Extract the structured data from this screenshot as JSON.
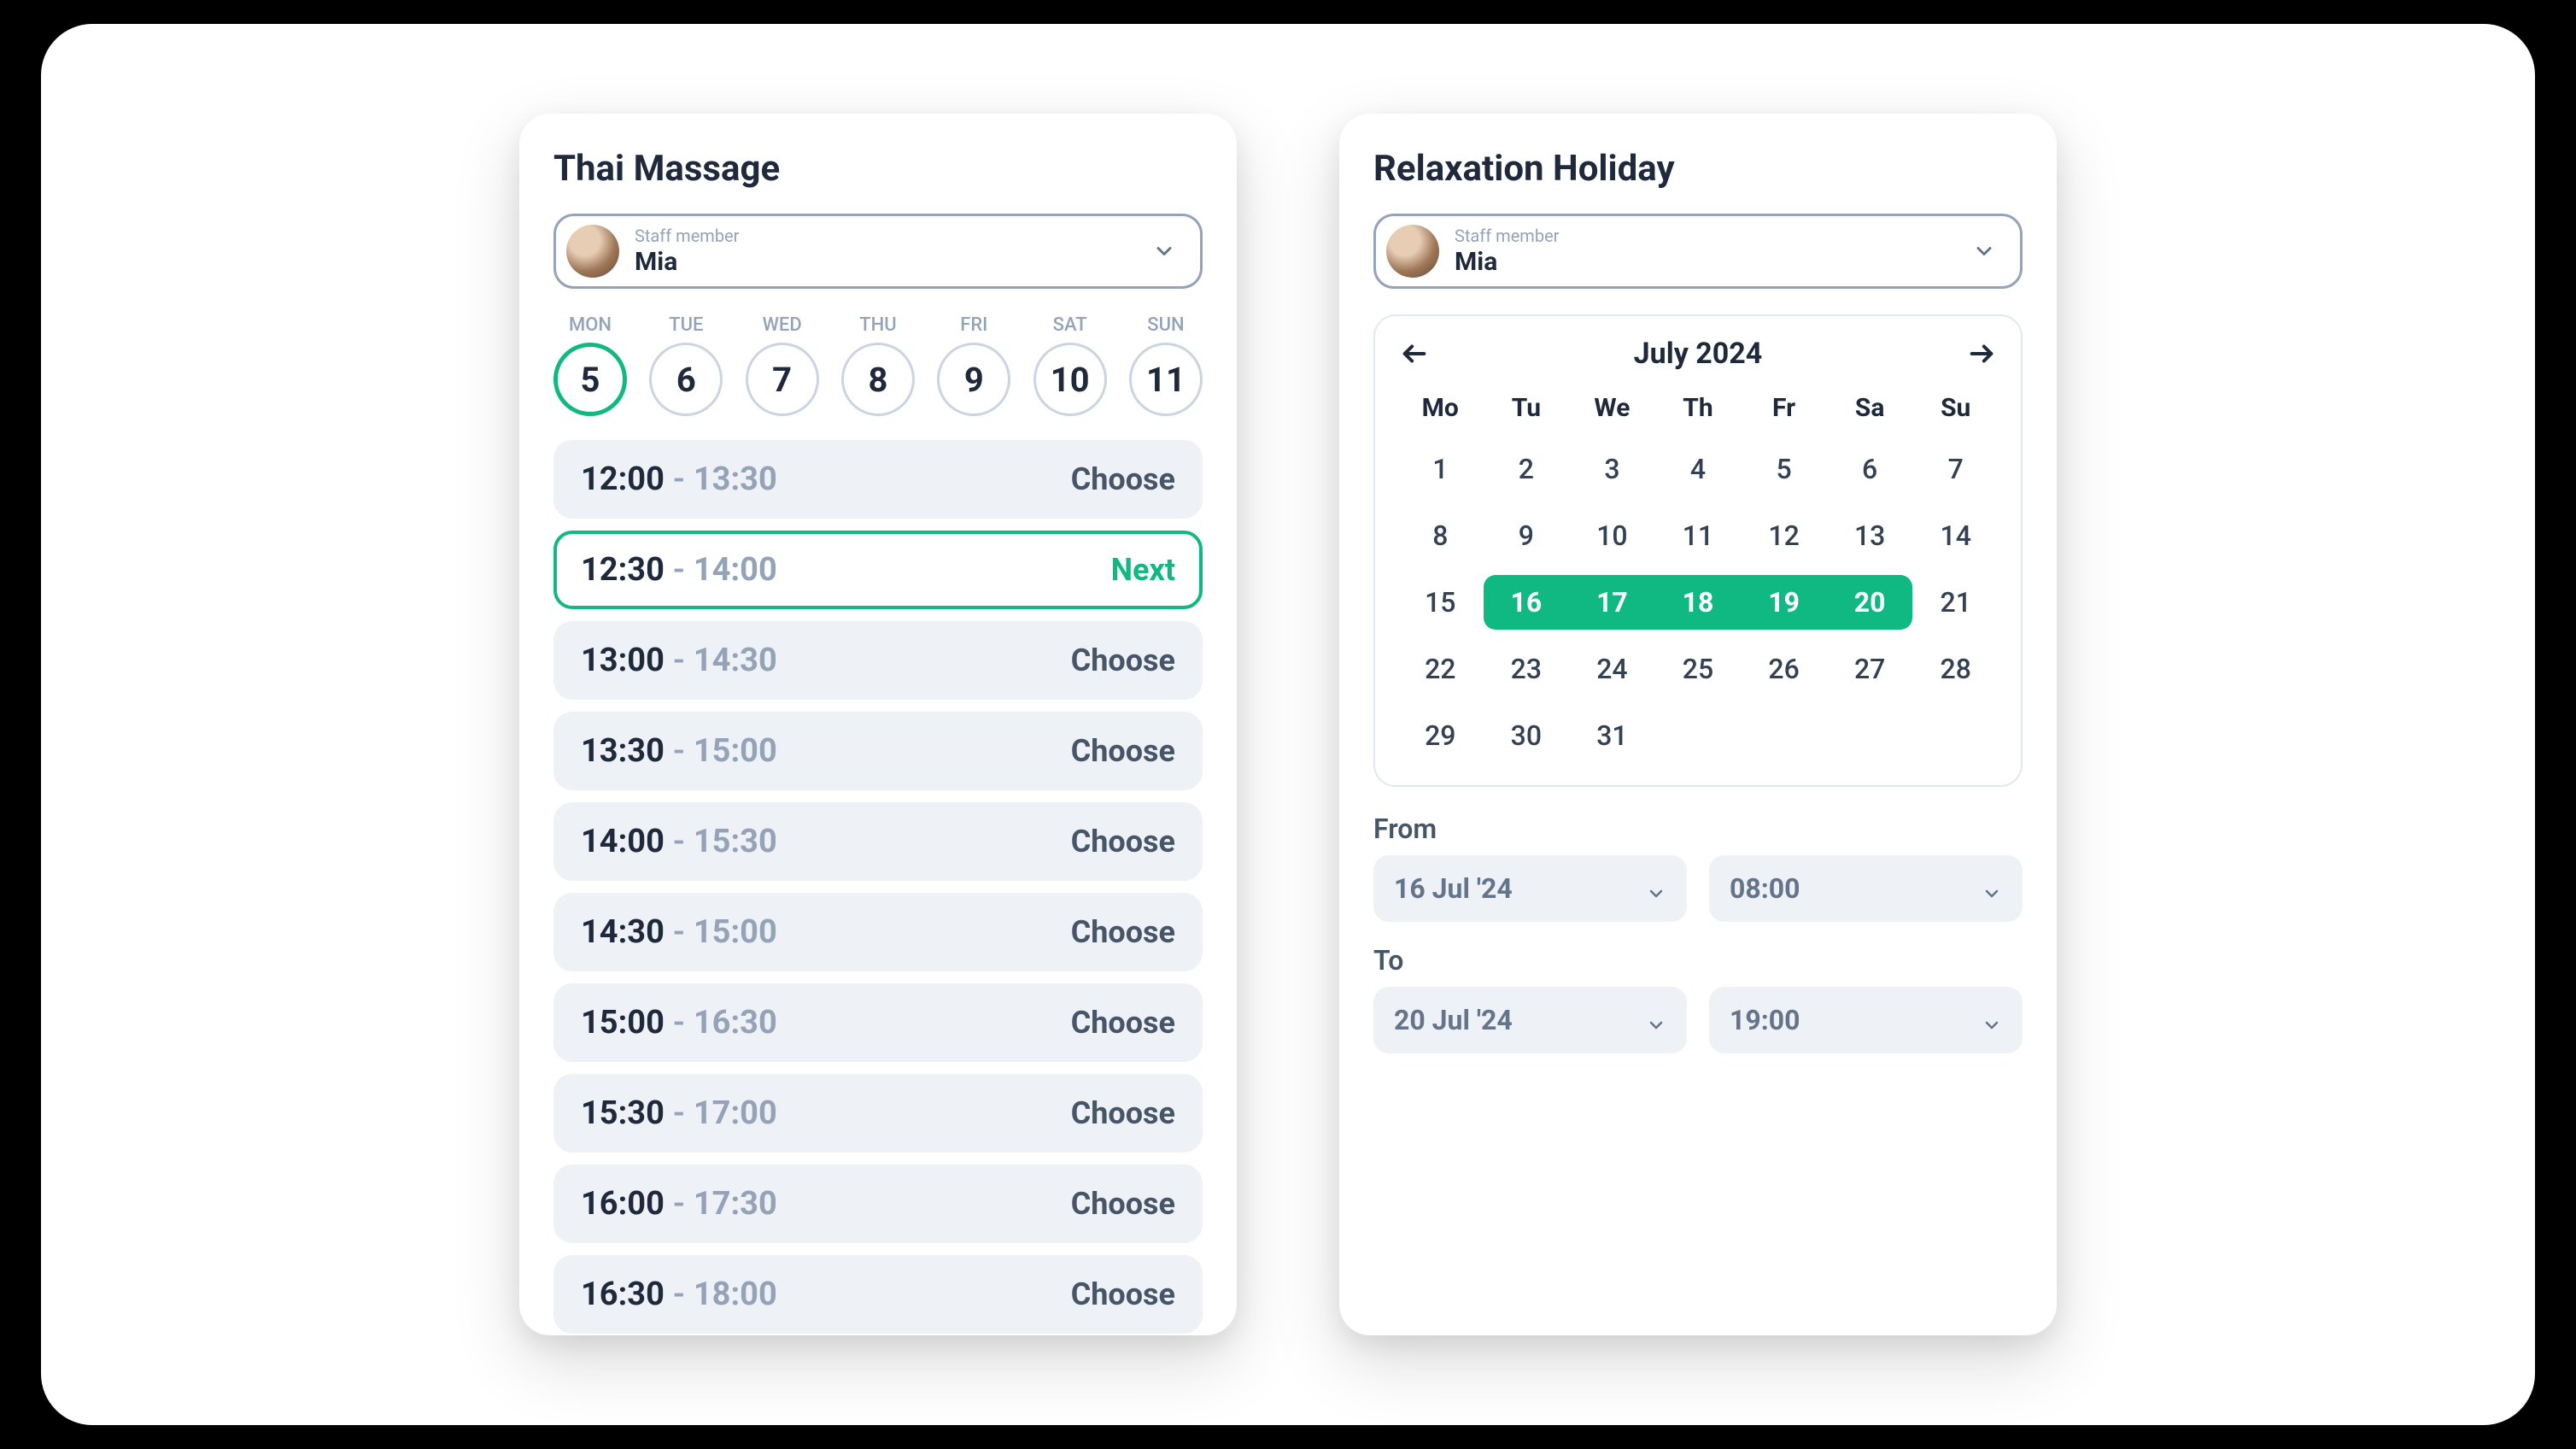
{
  "left": {
    "title": "Thai Massage",
    "staff_label": "Staff member",
    "staff_name": "Mia",
    "days": [
      {
        "abbr": "MON",
        "num": "5",
        "selected": true
      },
      {
        "abbr": "TUE",
        "num": "6",
        "selected": false
      },
      {
        "abbr": "WED",
        "num": "7",
        "selected": false
      },
      {
        "abbr": "THU",
        "num": "8",
        "selected": false
      },
      {
        "abbr": "FRI",
        "num": "9",
        "selected": false
      },
      {
        "abbr": "SAT",
        "num": "10",
        "selected": false
      },
      {
        "abbr": "SUN",
        "num": "11",
        "selected": false
      }
    ],
    "choose_label": "Choose",
    "next_label": "Next",
    "slots": [
      {
        "start": "12:00",
        "end": "13:30",
        "selected": false
      },
      {
        "start": "12:30",
        "end": "14:00",
        "selected": true
      },
      {
        "start": "13:00",
        "end": "14:30",
        "selected": false
      },
      {
        "start": "13:30",
        "end": "15:00",
        "selected": false
      },
      {
        "start": "14:00",
        "end": "15:30",
        "selected": false
      },
      {
        "start": "14:30",
        "end": "15:00",
        "selected": false
      },
      {
        "start": "15:00",
        "end": "16:30",
        "selected": false
      },
      {
        "start": "15:30",
        "end": "17:00",
        "selected": false
      },
      {
        "start": "16:00",
        "end": "17:30",
        "selected": false
      },
      {
        "start": "16:30",
        "end": "18:00",
        "selected": false
      }
    ]
  },
  "right": {
    "title": "Relaxation Holiday",
    "staff_label": "Staff member",
    "staff_name": "Mia",
    "month_label": "July 2024",
    "dow": [
      "Mo",
      "Tu",
      "We",
      "Th",
      "Fr",
      "Sa",
      "Su"
    ],
    "range_start": 16,
    "range_end": 20,
    "weeks": [
      [
        1,
        2,
        3,
        4,
        5,
        6,
        7
      ],
      [
        8,
        9,
        10,
        11,
        12,
        13,
        14
      ],
      [
        15,
        16,
        17,
        18,
        19,
        20,
        21
      ],
      [
        22,
        23,
        24,
        25,
        26,
        27,
        28
      ],
      [
        29,
        30,
        31,
        null,
        null,
        null,
        null
      ]
    ],
    "from_label": "From",
    "to_label": "To",
    "from_date": "16 Jul '24",
    "from_time": "08:00",
    "to_date": "20 Jul '24",
    "to_time": "19:00"
  }
}
